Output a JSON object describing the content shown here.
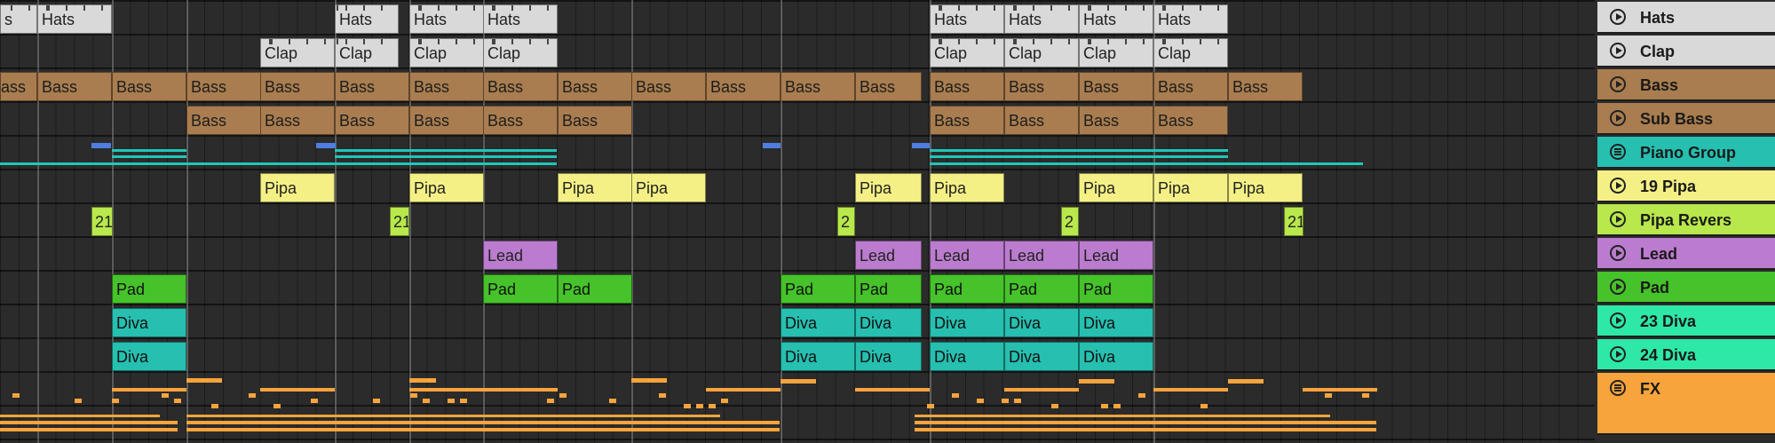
{
  "tracks": [
    {
      "key": "hats",
      "name": "Hats",
      "icon": "play-icon",
      "color": "#d9d9d9"
    },
    {
      "key": "clap",
      "name": "Clap",
      "icon": "play-icon",
      "color": "#d9d9d9"
    },
    {
      "key": "bass",
      "name": "Bass",
      "icon": "play-icon",
      "color": "#a97d4f"
    },
    {
      "key": "subbass",
      "name": "Sub Bass",
      "icon": "play-icon",
      "color": "#a97d4f"
    },
    {
      "key": "piano",
      "name": "Piano Group",
      "icon": "group-icon",
      "color": "#26bfb0"
    },
    {
      "key": "pipa",
      "name": "19 Pipa",
      "icon": "play-icon",
      "color": "#f4f085"
    },
    {
      "key": "pipareverse",
      "name": "Pipa Revers",
      "icon": "play-icon",
      "color": "#b8e84b"
    },
    {
      "key": "lead",
      "name": "Lead",
      "icon": "play-icon",
      "color": "#bb7ccf"
    },
    {
      "key": "pad",
      "name": "Pad",
      "icon": "play-icon",
      "color": "#46c22a"
    },
    {
      "key": "diva23",
      "name": "23 Diva",
      "icon": "play-icon",
      "color": "#2ee8a8"
    },
    {
      "key": "diva24",
      "name": "24 Diva",
      "icon": "play-icon",
      "color": "#2ee8a8"
    },
    {
      "key": "fx",
      "name": "FX",
      "icon": "group-icon",
      "color": "#f8a43c"
    }
  ],
  "clip_labels": {
    "hats": "Hats",
    "hats_cut": "s",
    "clap": "Clap",
    "bass": "Bass",
    "pipa": "Pipa",
    "pipa_rev_a": "21",
    "pipa_rev_b": "2",
    "lead": "Lead",
    "pad": "Pad",
    "diva": "Diva"
  }
}
